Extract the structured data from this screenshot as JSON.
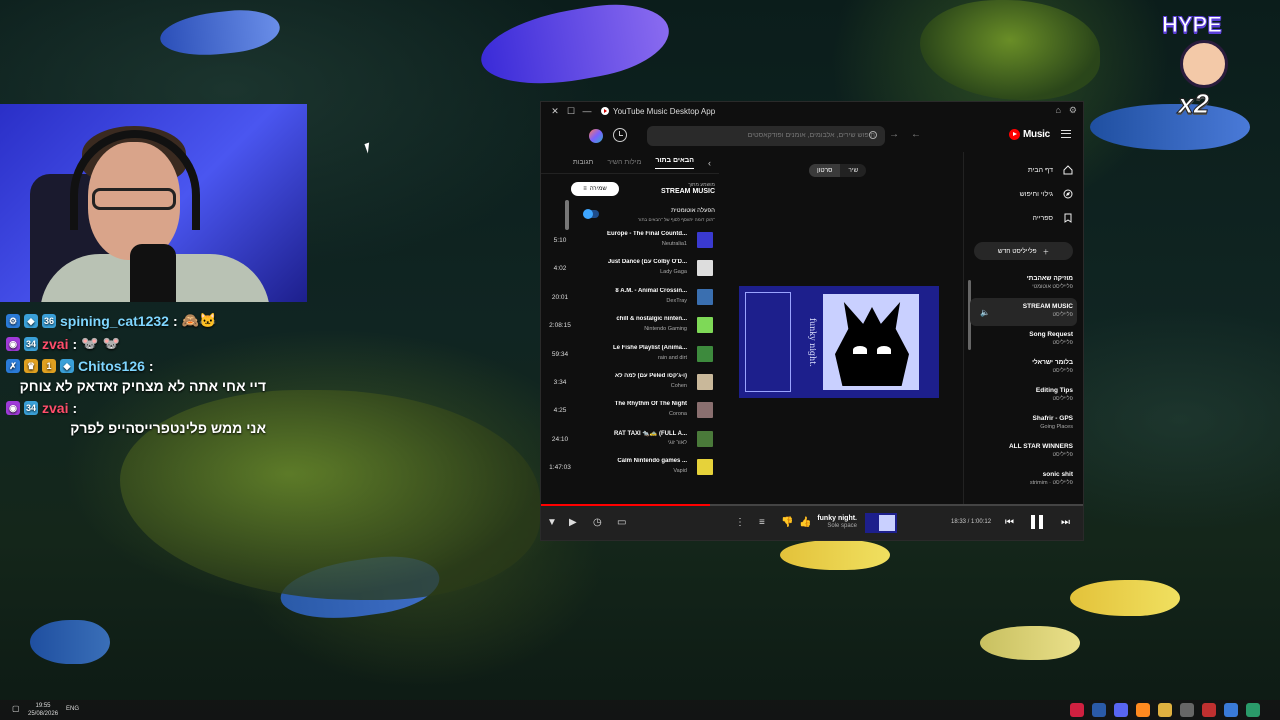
{
  "chat": {
    "lines": [
      {
        "user": "spining_cat1232",
        "user_color": "#7fd6ff",
        "sep": ":",
        "msg": "",
        "emotes": "🙈🐱"
      },
      {
        "user": "zvai",
        "user_color": "#ff4e6b",
        "sep": ":",
        "msg": "",
        "emotes": "🐭 🐭"
      },
      {
        "user": "Chitos126",
        "user_color": "#7fd6ff",
        "sep": ":",
        "msg": "דיי אחי אתה לא מצחיק זאדאק לא צוחק"
      },
      {
        "user": "zvai",
        "user_color": "#ff4e6b",
        "sep": ":",
        "msg": "אני ממש פלינטפרייסהייפ לפרק"
      }
    ]
  },
  "hype": {
    "label": "HYPE",
    "multiplier": "x2"
  },
  "app": {
    "title": "YouTube Music Desktop App",
    "search_placeholder": "חיפוש שירים, אלבומים, אומנים ופודקאסטים",
    "logo": "Music",
    "queue": {
      "tabs": [
        "הבאים בתור",
        "מילות השיר",
        "תגובות"
      ],
      "playing_from_label": "מושמע מתוך",
      "playing_from": "STREAM MUSIC",
      "save_label": "שמירה",
      "autoplay_title": "הפעלה אוטומטית",
      "autoplay_sub": "תוכן דומה יתווסף לסוף של \"הבאים בתור\"",
      "items": [
        {
          "title": "Europe - The Final Countd...",
          "artist": "Neutralia1",
          "duration": "5:10",
          "color": "#3a3ad0"
        },
        {
          "title": "Just Dance (עם Colby O'D...",
          "artist": "Lady Gaga",
          "duration": "4:02",
          "color": "#dddddd"
        },
        {
          "title": "8 A.M. - Animal Crossin...",
          "artist": "DexTray",
          "duration": "20:01",
          "color": "#3a6fb0"
        },
        {
          "title": "chill & nostalgic ninten...",
          "artist": "Nintendo Gaming",
          "duration": "2:08:15",
          "color": "#7ed957"
        },
        {
          "title": "Le Fishe Playlist (Anima...",
          "artist": "rain and dirt",
          "duration": "59:34",
          "color": "#3d8a3d"
        },
        {
          "title": "למה לא (עם Peled ו-ג'קסו)",
          "artist": "Cohen",
          "duration": "3:34",
          "color": "#c9b89a"
        },
        {
          "title": "The Rhythm Of The Night",
          "artist": "Corona",
          "duration": "4:25",
          "color": "#8a6f6f"
        },
        {
          "title": "RAT TAXI 🐀🚕 (FULL A...",
          "artist": "לאור זוגי",
          "duration": "24:10",
          "color": "#4a7a3a"
        },
        {
          "title": "Calm Nintendo games ...",
          "artist": "Vapid",
          "duration": "1:47:03",
          "color": "#e6d23a"
        }
      ]
    },
    "toggle": {
      "song": "שיר",
      "video": "סרטון"
    },
    "art_text": "funky night.",
    "sidebar": {
      "nav": [
        {
          "label": "דף הבית",
          "icon": "home-icon"
        },
        {
          "label": "גילוי וחיפוש",
          "icon": "explore-icon"
        },
        {
          "label": "ספרייה",
          "icon": "library-icon"
        }
      ],
      "new_playlist": "פלייליסט חדש",
      "playlists": [
        {
          "name": "מוזיקה שאהבתי",
          "sub": "פלייליסט אוטומטי"
        },
        {
          "name": "STREAM MUSIC",
          "sub": "פלייליסט"
        },
        {
          "name": "Song Request",
          "sub": "פלייליסט"
        },
        {
          "name": "בלומר ישראלי",
          "sub": "פלייליסט"
        },
        {
          "name": "Editing Tips",
          "sub": "פלייליסט"
        },
        {
          "name": "Shafrir - GPS",
          "sub": "Going Places"
        },
        {
          "name": "ALL STAR WINNERS",
          "sub": "פלייליסט"
        },
        {
          "name": "sonic shit",
          "sub": "strimim · פלייליסט"
        }
      ]
    },
    "player": {
      "title": "funky night.",
      "artist": "Sole space",
      "time": "18:33 / 1:00:12",
      "progress": 0.31
    }
  },
  "taskbar": {
    "time": "19:55",
    "date": "25/08/2026",
    "lang": "ENG"
  }
}
